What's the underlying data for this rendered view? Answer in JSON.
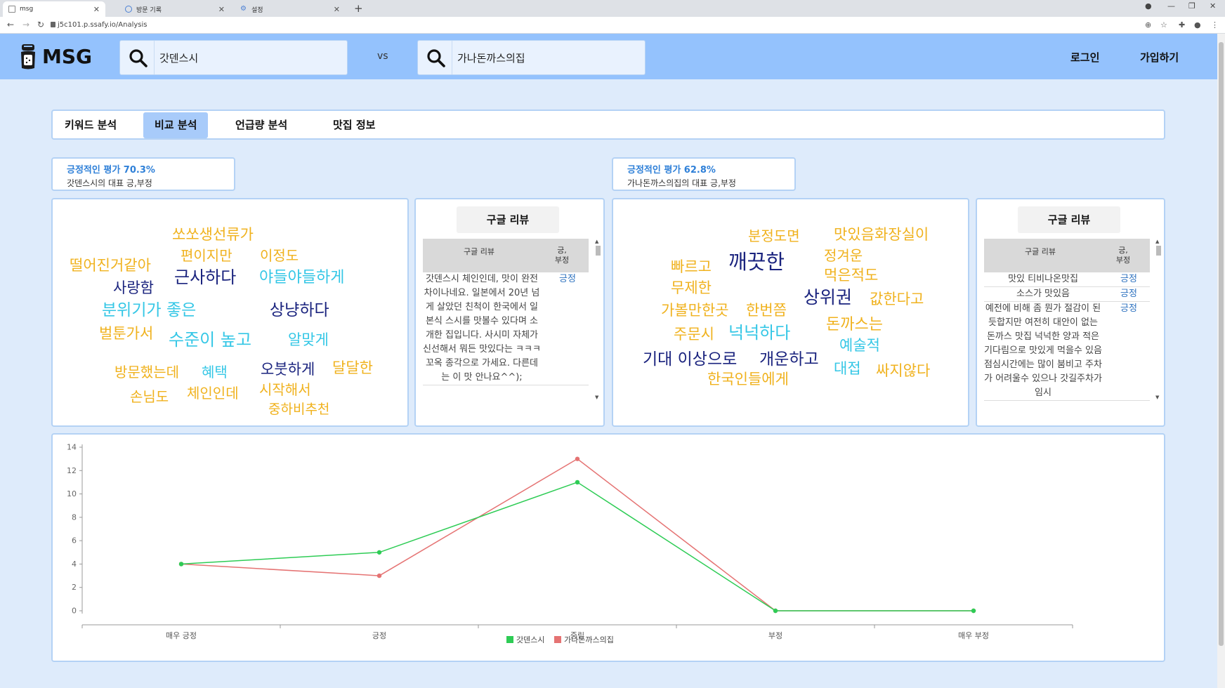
{
  "browser": {
    "tabs": [
      {
        "title": "msg",
        "active": true
      },
      {
        "title": "방문 기록",
        "active": false
      },
      {
        "title": "설정",
        "active": false
      }
    ],
    "url": "j5c101.p.ssafy.io/Analysis"
  },
  "header": {
    "logo": "MSG",
    "search1": "갓덴스시",
    "vs": "vs",
    "search2": "가나돈까스의집",
    "login": "로그인",
    "signup": "가입하기"
  },
  "menu": {
    "items": [
      "키워드 분석",
      "비교 분석",
      "언급량 분석",
      "맛집 정보"
    ],
    "active": "비교 분석"
  },
  "left": {
    "sentiment_title": "긍정적인 평가 70.3%",
    "sentiment_sub": "갓덴스시의 대표 긍,부정",
    "words": [
      {
        "text": "쏘쏘생선류가",
        "color": "#f0b21e"
      },
      {
        "text": "떨어진거같아",
        "color": "#f0b21e"
      },
      {
        "text": "편이지만",
        "color": "#f0b21e"
      },
      {
        "text": "이정도",
        "color": "#f0b21e"
      },
      {
        "text": "근사하다",
        "color": "#1a237e"
      },
      {
        "text": "야들야들하게",
        "color": "#35c7e6"
      },
      {
        "text": "사랑함",
        "color": "#1a237e"
      },
      {
        "text": "분위기가 좋은",
        "color": "#35c7e6"
      },
      {
        "text": "상냥하다",
        "color": "#1a237e"
      },
      {
        "text": "벌툰가서",
        "color": "#f0b21e"
      },
      {
        "text": "수준이 높고",
        "color": "#35c7e6"
      },
      {
        "text": "알맞게",
        "color": "#35c7e6"
      },
      {
        "text": "방문했는데",
        "color": "#f0b21e"
      },
      {
        "text": "혜택",
        "color": "#35c7e6"
      },
      {
        "text": "오붓하게",
        "color": "#1a237e"
      },
      {
        "text": "달달한",
        "color": "#f0b21e"
      },
      {
        "text": "손님도",
        "color": "#f0b21e"
      },
      {
        "text": "체인인데",
        "color": "#f0b21e"
      },
      {
        "text": "시작해서",
        "color": "#f0b21e"
      },
      {
        "text": "중하비추천",
        "color": "#f0b21e"
      }
    ],
    "review": {
      "button": "구글 리뷰",
      "col1": "구글 리뷰",
      "col2": "긍,\n부정",
      "rows": [
        {
          "text": "갓덴스시 체인인데, 맛이 완전 차이나네요. 일본에서 20년 넘게 살았던 친척이 한국에서 일본식 스시를 맛볼수 있다며 소개한 집입니다. 사시미 자체가 신선해서 뭐든 맛있다는 ㅋㅋㅋ 꼬옥 종각으로 가세요. 다른데는 이 맛 안나요^^);",
          "label": "긍정"
        }
      ]
    }
  },
  "right": {
    "sentiment_title": "긍정적인 평가 62.8%",
    "sentiment_sub": "가나돈까스의집의 대표 긍,부정",
    "words": [
      {
        "text": "분정도면",
        "color": "#f0b21e"
      },
      {
        "text": "맛있음화장실이",
        "color": "#f0b21e"
      },
      {
        "text": "빠르고",
        "color": "#f0b21e"
      },
      {
        "text": "깨끗한",
        "color": "#1a237e"
      },
      {
        "text": "정겨운",
        "color": "#f0b21e"
      },
      {
        "text": "먹은적도",
        "color": "#f0b21e"
      },
      {
        "text": "무제한",
        "color": "#f0b21e"
      },
      {
        "text": "상위권",
        "color": "#1a237e"
      },
      {
        "text": "가볼만한곳",
        "color": "#f0b21e"
      },
      {
        "text": "한번쯤",
        "color": "#f0b21e"
      },
      {
        "text": "값한다고",
        "color": "#f0b21e"
      },
      {
        "text": "돈까스는",
        "color": "#f0b21e"
      },
      {
        "text": "주문시",
        "color": "#f0b21e"
      },
      {
        "text": "넉넉하다",
        "color": "#35c7e6"
      },
      {
        "text": "예술적",
        "color": "#35c7e6"
      },
      {
        "text": "기대 이상으로",
        "color": "#1a237e"
      },
      {
        "text": "개운하고",
        "color": "#1a237e"
      },
      {
        "text": "대접",
        "color": "#35c7e6"
      },
      {
        "text": "싸지않다",
        "color": "#f0b21e"
      },
      {
        "text": "한국인들에게",
        "color": "#f0b21e"
      }
    ],
    "review": {
      "button": "구글 리뷰",
      "col1": "구글 리뷰",
      "col2": "긍,\n부정",
      "rows": [
        {
          "text": "맛있 티비나온맛집",
          "label": "긍정"
        },
        {
          "text": "소스가 맛있음",
          "label": "긍정"
        },
        {
          "text": "예전에 비해 좀 뭔가 절감이 된듯합지만 여전히 대안이 없는 돈까스 맛집 넉넉한 양과 적은 기다림으로 맛있게 먹을수 있음 점심시간에는 많이 붐비고 주차가 어려울수 있으나 갓길주차가 임시",
          "label": "긍정"
        }
      ]
    }
  },
  "chart_data": {
    "type": "line",
    "categories": [
      "매우 긍정",
      "긍정",
      "중립",
      "부정",
      "매우 부정"
    ],
    "ylim": [
      0,
      14
    ],
    "yticks": [
      0,
      2,
      4,
      6,
      8,
      10,
      12,
      14
    ],
    "series": [
      {
        "name": "갓덴스시",
        "color": "#2ecc55",
        "values": [
          4,
          5,
          11,
          0,
          0
        ]
      },
      {
        "name": "가나돈까스의집",
        "color": "#e57373",
        "values": [
          4,
          3,
          13,
          0,
          0
        ]
      }
    ]
  }
}
